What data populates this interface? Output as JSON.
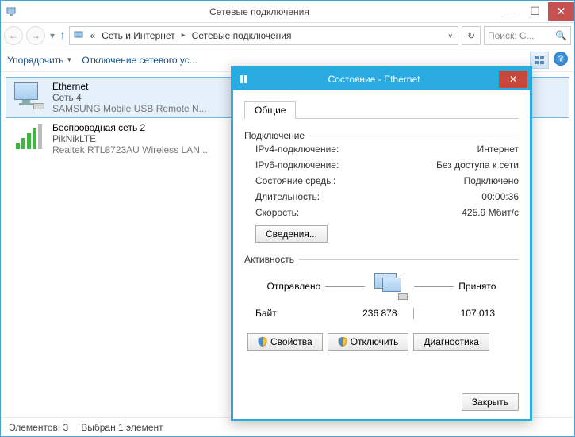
{
  "window": {
    "title": "Сетевые подключения"
  },
  "nav": {
    "crumb_prefix": "«",
    "crumb1": "Сеть и Интернет",
    "crumb2": "Сетевые подключения",
    "search_placeholder": "Поиск: С..."
  },
  "toolbar": {
    "organize": "Упорядочить",
    "disable": "Отключение сетевого ус..."
  },
  "items": [
    {
      "name": "Ethernet",
      "sub": "Сеть  4",
      "dev": "SAMSUNG Mobile USB Remote N..."
    },
    {
      "name": "Беспроводная сеть 2",
      "sub": "PikNikLTE",
      "dev": "Realtek RTL8723AU Wireless LAN ..."
    }
  ],
  "statusbar": {
    "count": "Элементов: 3",
    "selected": "Выбран 1 элемент"
  },
  "dialog": {
    "title": "Состояние - Ethernet",
    "tab_general": "Общие",
    "section_conn": "Подключение",
    "ipv4_k": "IPv4-подключение:",
    "ipv4_v": "Интернет",
    "ipv6_k": "IPv6-подключение:",
    "ipv6_v": "Без доступа к сети",
    "media_k": "Состояние среды:",
    "media_v": "Подключено",
    "duration_k": "Длительность:",
    "duration_v": "00:00:36",
    "speed_k": "Скорость:",
    "speed_v": "425.9 Мбит/с",
    "details_btn": "Сведения...",
    "section_act": "Активность",
    "sent_lbl": "Отправлено",
    "recv_lbl": "Принято",
    "bytes_lbl": "Байт:",
    "bytes_sent": "236 878",
    "bytes_recv": "107 013",
    "props_btn": "Свойства",
    "disable_btn": "Отключить",
    "diag_btn": "Диагностика",
    "close_btn": "Закрыть"
  }
}
